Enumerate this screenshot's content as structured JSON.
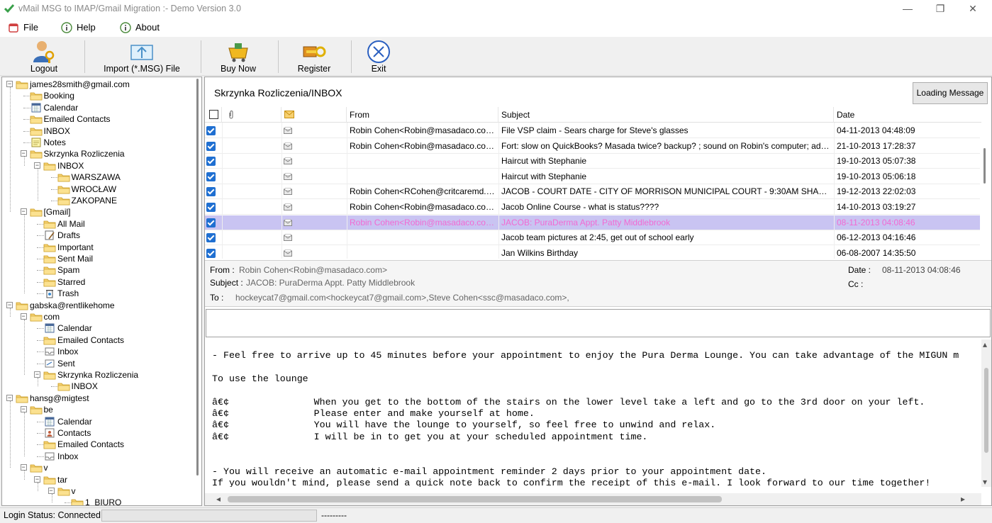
{
  "window": {
    "title": "vMail MSG to IMAP/Gmail Migration :- Demo Version 3.0",
    "minimize": "—",
    "restore": "❐",
    "close": "✕"
  },
  "menu": [
    {
      "label": "File",
      "icon": "file-icon"
    },
    {
      "label": "Help",
      "icon": "info-icon"
    },
    {
      "label": "About",
      "icon": "info-icon"
    }
  ],
  "toolbar": {
    "logout": "Logout",
    "import": "Import (*.MSG) File",
    "buy_now": "Buy Now",
    "register": "Register",
    "exit": "Exit"
  },
  "tree": [
    {
      "label": "james28smith@gmail.com",
      "icon": "folder",
      "depth": 0,
      "expander": "−"
    },
    {
      "label": "Booking",
      "icon": "folder",
      "depth": 1
    },
    {
      "label": "Calendar",
      "icon": "calendar",
      "depth": 1
    },
    {
      "label": "Emailed Contacts",
      "icon": "folder",
      "depth": 1
    },
    {
      "label": "INBOX",
      "icon": "folder",
      "depth": 1
    },
    {
      "label": "Notes",
      "icon": "note",
      "depth": 1
    },
    {
      "label": "Skrzynka Rozliczenia",
      "icon": "folder",
      "depth": 1,
      "expander": "−"
    },
    {
      "label": "INBOX",
      "icon": "folder",
      "depth": 2,
      "expander": "−"
    },
    {
      "label": "WARSZAWA",
      "icon": "folder",
      "depth": 3
    },
    {
      "label": "WROCŁAW",
      "icon": "folder",
      "depth": 3
    },
    {
      "label": "ZAKOPANE",
      "icon": "folder",
      "depth": 3
    },
    {
      "label": "[Gmail]",
      "icon": "folder",
      "depth": 1,
      "expander": "−"
    },
    {
      "label": "All Mail",
      "icon": "folder",
      "depth": 2
    },
    {
      "label": "Drafts",
      "icon": "drafts",
      "depth": 2
    },
    {
      "label": "Important",
      "icon": "folder",
      "depth": 2
    },
    {
      "label": "Sent Mail",
      "icon": "folder",
      "depth": 2
    },
    {
      "label": "Spam",
      "icon": "folder",
      "depth": 2
    },
    {
      "label": "Starred",
      "icon": "folder",
      "depth": 2
    },
    {
      "label": "Trash",
      "icon": "trash",
      "depth": 2
    },
    {
      "label": "gabska@rentlikehome",
      "icon": "folder",
      "depth": 0,
      "expander": "−"
    },
    {
      "label": "com",
      "icon": "folder",
      "depth": 1,
      "expander": "−"
    },
    {
      "label": "Calendar",
      "icon": "calendar",
      "depth": 2
    },
    {
      "label": "Emailed Contacts",
      "icon": "folder",
      "depth": 2
    },
    {
      "label": "Inbox",
      "icon": "inbox",
      "depth": 2
    },
    {
      "label": "Sent",
      "icon": "sent",
      "depth": 2
    },
    {
      "label": "Skrzynka Rozliczenia",
      "icon": "folder",
      "depth": 2,
      "expander": "−"
    },
    {
      "label": "INBOX",
      "icon": "folder",
      "depth": 3
    },
    {
      "label": "hansg@migtest",
      "icon": "folder",
      "depth": 0,
      "expander": "−"
    },
    {
      "label": "be",
      "icon": "folder",
      "depth": 1,
      "expander": "−"
    },
    {
      "label": "Calendar",
      "icon": "calendar",
      "depth": 2
    },
    {
      "label": "Contacts",
      "icon": "contacts",
      "depth": 2
    },
    {
      "label": "Emailed Contacts",
      "icon": "folder",
      "depth": 2
    },
    {
      "label": "Inbox",
      "icon": "inbox",
      "depth": 2
    },
    {
      "label": "v",
      "icon": "folder",
      "depth": 1,
      "expander": "−"
    },
    {
      "label": "tar",
      "icon": "folder",
      "depth": 2,
      "expander": "−"
    },
    {
      "label": "v",
      "icon": "folder",
      "depth": 3,
      "expander": "−"
    },
    {
      "label": "1_BIURO",
      "icon": "folder",
      "depth": 4
    }
  ],
  "folder_path": "Skrzynka Rozliczenia/INBOX",
  "loading_button": "Loading Message",
  "columns": {
    "from": "From",
    "subject": "Subject",
    "date": "Date"
  },
  "messages": [
    {
      "from": "Robin Cohen<Robin@masadaco.com>",
      "subject": "File VSP claim - Sears charge for Steve's glasses",
      "date": "04-11-2013 04:48:09",
      "checked": true,
      "selected": false
    },
    {
      "from": "Robin Cohen<Robin@masadaco.com>",
      "subject": "Fort:  slow on QuickBooks? Masada twice?  backup? ; sound on Robin's computer; add pdf pr...",
      "date": "21-10-2013 17:28:37",
      "checked": true,
      "selected": false
    },
    {
      "from": "",
      "subject": "Haircut with Stephanie",
      "date": "19-10-2013 05:07:38",
      "checked": true,
      "selected": false
    },
    {
      "from": "",
      "subject": "Haircut with Stephanie",
      "date": "19-10-2013 05:06:18",
      "checked": true,
      "selected": false
    },
    {
      "from": "Robin Cohen<RCohen@critcaremd.com>",
      "subject": "JACOB - COURT DATE - CITY OF MORRISON MUNICIPAL COURT - 9:30AM SHARP!",
      "date": "19-12-2013 22:02:03",
      "checked": true,
      "selected": false
    },
    {
      "from": "Robin Cohen<Robin@masadaco.com>",
      "subject": "Jacob Online Course - what is status????",
      "date": "14-10-2013 03:19:27",
      "checked": true,
      "selected": false
    },
    {
      "from": "Robin Cohen<Robin@masadaco.com>",
      "subject": "JACOB: PuraDerma Appt. Patty Middlebrook",
      "date": "08-11-2013 04:08:46",
      "checked": true,
      "selected": true
    },
    {
      "from": "",
      "subject": "Jacob team pictures at 2:45, get out of school early",
      "date": "06-12-2013 04:16:46",
      "checked": true,
      "selected": false
    },
    {
      "from": "",
      "subject": "Jan Wilkins Birthday",
      "date": "06-08-2007 14:35:50",
      "checked": true,
      "selected": false
    }
  ],
  "header": {
    "from_label": "From :",
    "from_value": "Robin Cohen<Robin@masadaco.com>",
    "subject_label": "Subject :",
    "subject_value": "JACOB: PuraDerma Appt. Patty Middlebrook",
    "to_label": "To :",
    "to_value": "hockeycat7@gmail.com<hockeycat7@gmail.com>,Steve Cohen<ssc@masadaco.com>,",
    "date_label": "Date :",
    "date_value": "08-11-2013 04:08:46",
    "cc_label": "Cc :",
    "cc_value": ""
  },
  "body_lines": [
    "- Feel free to arrive up to 45 minutes before your appointment to enjoy the Pura Derma Lounge. You can take advantage of the MIGUN m",
    "",
    "To use the lounge",
    "",
    "â€¢               When you get to the bottom of the stairs on the lower level take a left and go to the 3rd door on your left.",
    "â€¢               Please enter and make yourself at home.",
    "â€¢               You will have the lounge to yourself, so feel free to unwind and relax.",
    "â€¢               I will be in to get you at your scheduled appointment time.",
    "",
    "",
    "- You will receive an automatic e-mail appointment reminder 2 days prior to your appointment date.",
    "If you wouldn't mind, please send a quick note back to confirm the receipt of this e-mail. I look forward to our time together!"
  ],
  "status": {
    "label": "Login Status: Connected",
    "dashes": "---------"
  }
}
